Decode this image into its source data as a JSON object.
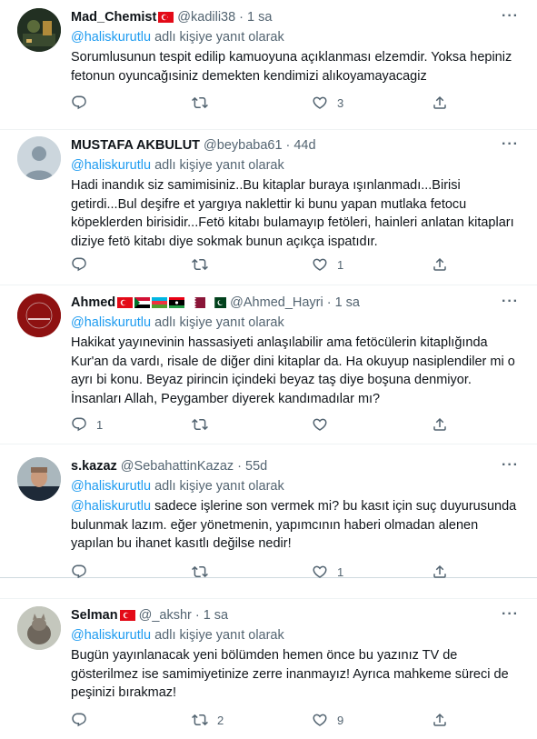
{
  "reply_label": "adlı kişiye yanıt olarak",
  "more_label": "···",
  "tweets": [
    {
      "name": "Mad_Chemist",
      "handle": "@kadili38",
      "time": "1 sa",
      "reply_to": "@haliskurutlu",
      "text_mention": "",
      "text": "Sorumlusunun tespit edilip kamuoyuna açıklanması elzemdir. Yoksa hepiniz fetonun oyuncağısiniz demekten kendimizi alıkoyamayacagiz",
      "replies": "",
      "retweets": "",
      "likes": "3"
    },
    {
      "name": "MUSTAFA AKBULUT",
      "handle": "@beybaba61",
      "time": "44d",
      "reply_to": "@haliskurutlu",
      "text_mention": "",
      "text": "Hadi inandık siz samimisiniz..Bu kitaplar buraya ışınlanmadı...Birisi getirdi...Bul deşifre et yargıya naklettir ki bunu yapan mutlaka fetocu köpeklerden birisidir...Fetö kitabı bulamayıp fetöleri, hainleri anlatan kitapları diziye fetö kitabı diye sokmak bunun açıkça ispatıdır.",
      "replies": "",
      "retweets": "",
      "likes": "1"
    },
    {
      "name": "Ahmed",
      "handle": "@Ahmed_Hayri",
      "time": "1 sa",
      "reply_to": "@haliskurutlu",
      "text_mention": "",
      "text": "Hakikat yayınevinin hassasiyeti anlaşılabilir ama fetöcülerin kitaplığında Kur'an da vardı, risale de diğer dini kitaplar da. Ha okuyup nasiplendiler mi o ayrı bi konu. Beyaz pirincin içindeki beyaz taş diye boşuna denmiyor. İnsanları Allah, Peygamber diyerek kandımadılar mı?",
      "replies": "1",
      "retweets": "",
      "likes": ""
    },
    {
      "name": "s.kazaz",
      "handle": "@SebahattinKazaz",
      "time": "55d",
      "reply_to": "@haliskurutlu",
      "text_mention": "@haliskurutlu",
      "text": " sadece işlerine son vermek mi? bu kasıt için suç duyurusunda bulunmak lazım. eğer yönetmenin, yapımcının haberi olmadan alenen yapılan bu ihanet kasıtlı değilse nedir!",
      "replies": "",
      "retweets": "",
      "likes": "1"
    },
    {
      "name": "Selman",
      "handle": "@_akshr",
      "time": "1 sa",
      "reply_to": "@haliskurutlu",
      "text_mention": "",
      "text": "Bugün yayınlanacak yeni bölümden hemen önce bu yazınız TV de gösterilmez ise samimiyetinize zerre inanmayız! Ayrıca mahkeme süreci de peşinizi bırakmaz!",
      "replies": "",
      "retweets": "2",
      "likes": "9"
    }
  ],
  "colors": {
    "link": "#1d9bf0",
    "secondary": "#536471",
    "text": "#0f1419",
    "divider": "#eff3f4"
  },
  "icons": [
    "reply-icon",
    "retweet-icon",
    "like-icon",
    "share-icon",
    "more-icon"
  ]
}
